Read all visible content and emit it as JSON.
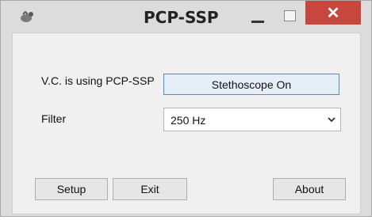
{
  "window": {
    "title": "PCP-SSP",
    "close_symbol": "✕",
    "icons": {
      "app": "app-icon",
      "minimize": "minimize-icon",
      "maximize": "maximize-icon",
      "close": "close-icon"
    },
    "colors": {
      "close_bg": "#c7473e",
      "chrome": "#dcdcdc",
      "client": "#f0f0f0"
    }
  },
  "status": {
    "label": "V.C. is using PCP-SSP"
  },
  "stethoscope_button": {
    "label": "Stethoscope On"
  },
  "filter": {
    "label": "Filter",
    "selected": "250 Hz",
    "dropdown_icon": "chevron-down-icon"
  },
  "footer": {
    "setup_label": "Setup",
    "exit_label": "Exit",
    "about_label": "About"
  }
}
